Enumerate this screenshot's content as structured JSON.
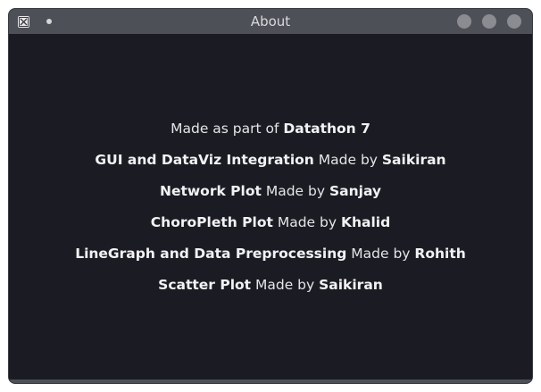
{
  "window": {
    "title": "About"
  },
  "credits": {
    "line1": {
      "prefix": "Made as part of ",
      "bold": "Datathon 7"
    },
    "line2": {
      "bold1": "GUI and DataViz Integration",
      "mid": " Made by ",
      "bold2": "Saikiran"
    },
    "line3": {
      "bold1": "Network Plot",
      "mid": " Made by ",
      "bold2": "Sanjay"
    },
    "line4": {
      "bold1": "ChoroPleth Plot",
      "mid": " Made by ",
      "bold2": "Khalid"
    },
    "line5": {
      "bold1": "LineGraph and Data Preprocessing",
      "mid": " Made by ",
      "bold2": "Rohith"
    },
    "line6": {
      "bold1": "Scatter Plot",
      "mid": " Made by ",
      "bold2": "Saikiran"
    }
  },
  "colors": {
    "background": "#1b1c23",
    "titlebar": "#4e5057",
    "text": "#e4e5e8"
  }
}
